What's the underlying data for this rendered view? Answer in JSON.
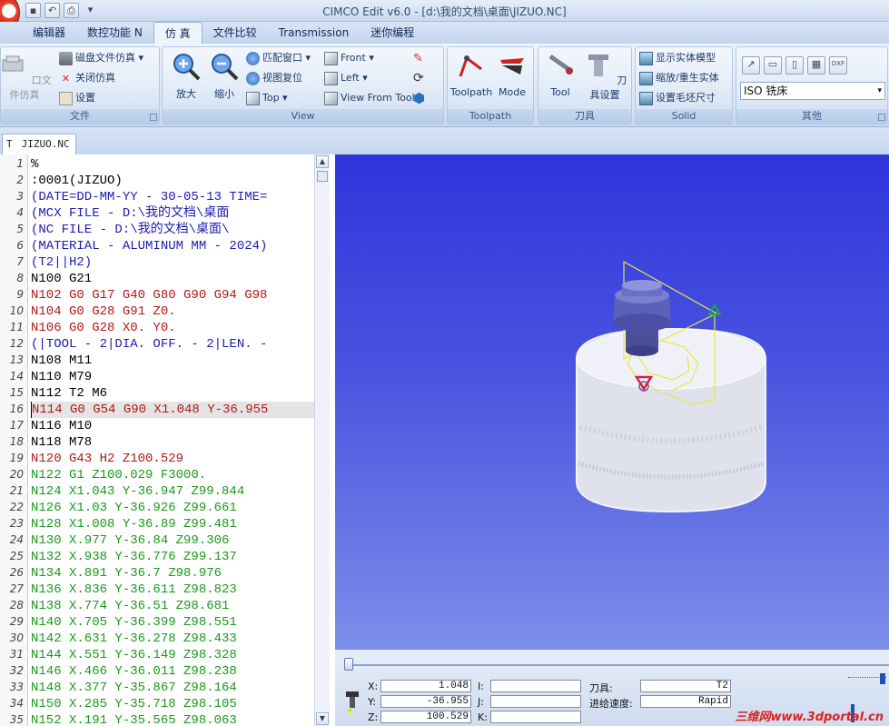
{
  "title": "CIMCO Edit v6.0 - [d:\\我的文档\\桌面\\JIZUO.NC]",
  "qat": [
    "save-icon",
    "undo-icon",
    "print-icon",
    "dropdown-icon"
  ],
  "tabs": [
    "编辑器",
    "数控功能 N",
    "仿 真",
    "文件比较",
    "Transmission",
    "迷你编程"
  ],
  "groups": {
    "file": {
      "label": "文件",
      "btn": "口文件仿真",
      "items": [
        "磁盘文件仿真 ▾",
        "关闭仿真",
        "设置"
      ]
    },
    "view": {
      "label": "View",
      "zoom_in": "放大",
      "zoom_out": "缩小",
      "items": [
        "匹配窗口 ▾",
        "视图复位",
        "Top ▾",
        "Front ▾",
        "Left ▾",
        "View From Tool"
      ]
    },
    "toolpath": {
      "label": "Toolpath",
      "btns": [
        "Toolpath",
        "Mode"
      ]
    },
    "tool": {
      "label": "刀具",
      "btns": [
        "Tool",
        "刀具设置"
      ]
    },
    "solid": {
      "label": "Solid",
      "items": [
        "显示实体模型",
        "缩放/重生实体",
        "设置毛坯尺寸"
      ]
    },
    "other": {
      "label": "其他",
      "combo": "ISO 铣床"
    }
  },
  "doc_tab": "JIZUO.NC",
  "lines": [
    {
      "n": "1",
      "t": "%",
      "c": "#000"
    },
    {
      "n": "2",
      "t": ":0001(JIZUO)",
      "c": "#000"
    },
    {
      "n": "3",
      "t": "(DATE=DD-MM-YY - 30-05-13 TIME=",
      "c": "#1c1cb0"
    },
    {
      "n": "4",
      "t": "(MCX FILE - D:\\我的文档\\桌面",
      "c": "#1c1cb0"
    },
    {
      "n": "5",
      "t": "(NC FILE - D:\\我的文档\\桌面\\",
      "c": "#1c1cb0"
    },
    {
      "n": "6",
      "t": "(MATERIAL - ALUMINUM MM - 2024)",
      "c": "#1c1cb0"
    },
    {
      "n": "7",
      "t": "(T2||H2)",
      "c": "#1c1cb0"
    },
    {
      "n": "8",
      "t": "N100 G21",
      "c": "#000"
    },
    {
      "n": "9",
      "t": "N102 G0 G17 G40 G80 G90 G94 G98",
      "c": "#b01818"
    },
    {
      "n": "10",
      "t": "N104 G0 G28 G91 Z0.",
      "c": "#b01818"
    },
    {
      "n": "11",
      "t": "N106 G0 G28 X0. Y0.",
      "c": "#b01818"
    },
    {
      "n": "12",
      "t": "(|TOOL - 2|DIA. OFF. - 2|LEN. -",
      "c": "#1c1cb0"
    },
    {
      "n": "13",
      "t": "N108 M11",
      "c": "#000"
    },
    {
      "n": "14",
      "t": "N110 M79",
      "c": "#000"
    },
    {
      "n": "15",
      "t": "N112 T2 M6",
      "c": "#000"
    },
    {
      "n": "16",
      "t": "N114 G0 G54 G90 X1.048 Y-36.955",
      "c": "#b01818"
    },
    {
      "n": "17",
      "t": "N116 M10",
      "c": "#000"
    },
    {
      "n": "18",
      "t": "N118 M78",
      "c": "#000"
    },
    {
      "n": "19",
      "t": "N120 G43 H2 Z100.529",
      "c": "#b01818"
    },
    {
      "n": "20",
      "t": "N122 G1 Z100.029 F3000.",
      "c": "#1a9a1a"
    },
    {
      "n": "21",
      "t": "N124 X1.043 Y-36.947 Z99.844",
      "c": "#1a9a1a"
    },
    {
      "n": "22",
      "t": "N126 X1.03 Y-36.926 Z99.661",
      "c": "#1a9a1a"
    },
    {
      "n": "23",
      "t": "N128 X1.008 Y-36.89 Z99.481",
      "c": "#1a9a1a"
    },
    {
      "n": "24",
      "t": "N130 X.977 Y-36.84 Z99.306",
      "c": "#1a9a1a"
    },
    {
      "n": "25",
      "t": "N132 X.938 Y-36.776 Z99.137",
      "c": "#1a9a1a"
    },
    {
      "n": "26",
      "t": "N134 X.891 Y-36.7 Z98.976",
      "c": "#1a9a1a"
    },
    {
      "n": "27",
      "t": "N136 X.836 Y-36.611 Z98.823",
      "c": "#1a9a1a"
    },
    {
      "n": "28",
      "t": "N138 X.774 Y-36.51 Z98.681",
      "c": "#1a9a1a"
    },
    {
      "n": "29",
      "t": "N140 X.705 Y-36.399 Z98.551",
      "c": "#1a9a1a"
    },
    {
      "n": "30",
      "t": "N142 X.631 Y-36.278 Z98.433",
      "c": "#1a9a1a"
    },
    {
      "n": "31",
      "t": "N144 X.551 Y-36.149 Z98.328",
      "c": "#1a9a1a"
    },
    {
      "n": "32",
      "t": "N146 X.466 Y-36.011 Z98.238",
      "c": "#1a9a1a"
    },
    {
      "n": "33",
      "t": "N148 X.377 Y-35.867 Z98.164",
      "c": "#1a9a1a"
    },
    {
      "n": "34",
      "t": "N150 X.285 Y-35.718 Z98.105",
      "c": "#1a9a1a"
    },
    {
      "n": "35",
      "t": "N152 X.191 Y-35.565 Z98.063",
      "c": "#1a9a1a"
    }
  ],
  "current_line": "16",
  "coords": {
    "x_label": "X:",
    "x_val": "1.048",
    "y_label": "Y:",
    "y_val": "-36.955",
    "z_label": "Z:",
    "z_val": "100.529",
    "i_label": "I:",
    "j_label": "J:",
    "k_label": "K:",
    "tool_label": "刀具:",
    "tool_val": "T2",
    "feed_label": "进给速度:",
    "feed_val": "Rapid"
  },
  "watermark": "三维网www.3dportal.cn"
}
